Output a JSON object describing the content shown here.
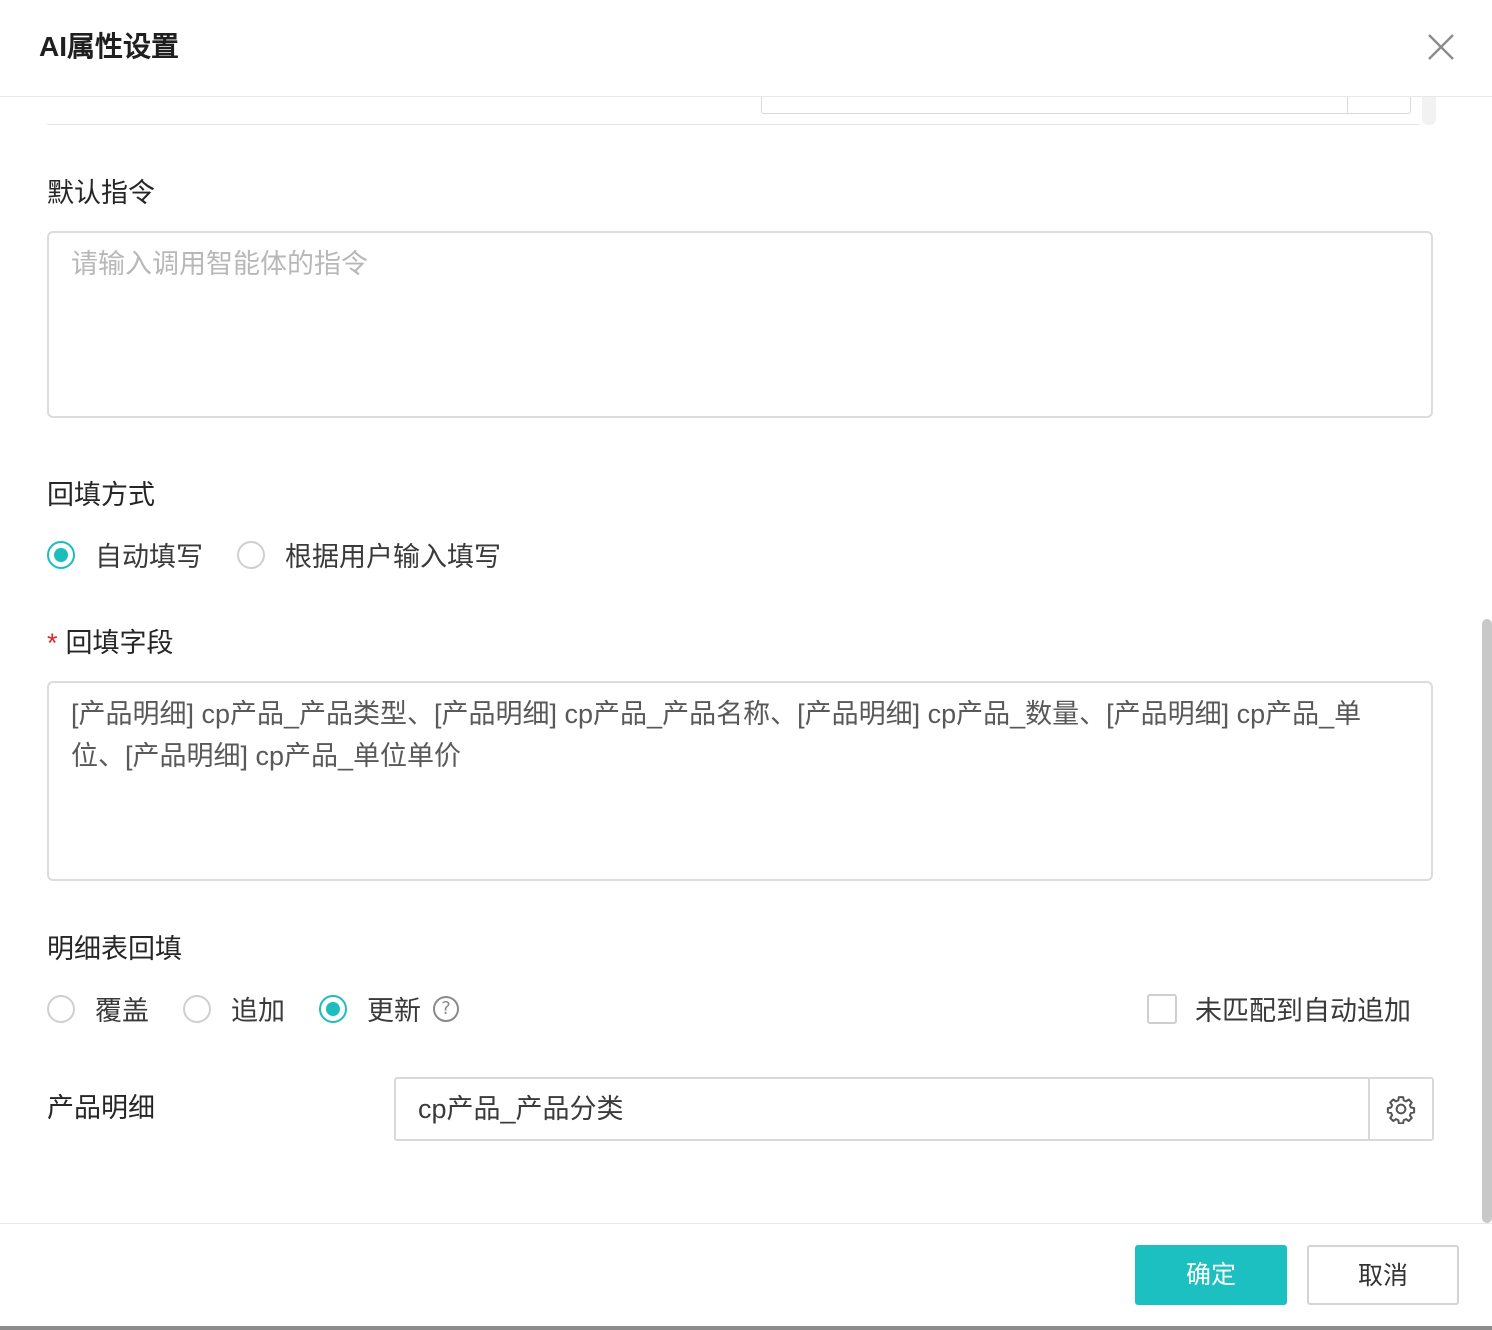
{
  "dialog": {
    "title": "AI属性设置"
  },
  "default_instruction": {
    "label": "默认指令",
    "placeholder": "请输入调用智能体的指令"
  },
  "backfill_mode": {
    "label": "回填方式",
    "options": [
      {
        "label": "自动填写",
        "checked": true
      },
      {
        "label": "根据用户输入填写",
        "checked": false
      }
    ]
  },
  "backfill_fields": {
    "required_mark": "*",
    "label": "回填字段",
    "value": "[产品明细] cp产品_产品类型、[产品明细] cp产品_产品名称、[产品明细] cp产品_数量、[产品明细] cp产品_单位、[产品明细] cp产品_单位单价"
  },
  "detail_backfill": {
    "label": "明细表回填",
    "options": [
      {
        "label": "覆盖",
        "checked": false
      },
      {
        "label": "追加",
        "checked": false
      },
      {
        "label": "更新",
        "checked": true
      }
    ],
    "help_glyph": "?",
    "auto_append": {
      "label": "未匹配到自动追加",
      "checked": false
    }
  },
  "product_detail": {
    "label": "产品明细",
    "value": "cp产品_产品分类"
  },
  "footer": {
    "confirm_label": "确定",
    "cancel_label": "取消"
  },
  "colors": {
    "accent": "#1cc0c0",
    "required": "#e02424"
  }
}
